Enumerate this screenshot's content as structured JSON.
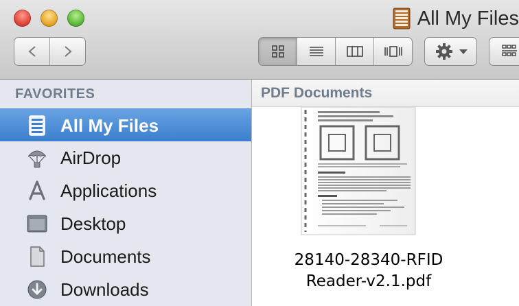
{
  "window": {
    "title": "All My Files",
    "title_icon": "all-my-files-icon"
  },
  "toolbar": {
    "nav_back_icon": "back-arrow-icon",
    "nav_forward_icon": "forward-arrow-icon",
    "views": [
      "icon-view",
      "list-view",
      "column-view",
      "cover-flow-view"
    ],
    "active_view": "icon-view",
    "action_icon": "gear-icon",
    "arrange_icon": "arrange-icon"
  },
  "sidebar": {
    "header": "FAVORITES",
    "items": [
      {
        "label": "All My Files",
        "icon": "all-my-files-icon",
        "selected": true
      },
      {
        "label": "AirDrop",
        "icon": "airdrop-icon",
        "selected": false
      },
      {
        "label": "Applications",
        "icon": "applications-icon",
        "selected": false
      },
      {
        "label": "Desktop",
        "icon": "desktop-icon",
        "selected": false
      },
      {
        "label": "Documents",
        "icon": "documents-icon",
        "selected": false
      },
      {
        "label": "Downloads",
        "icon": "downloads-icon",
        "selected": false
      }
    ]
  },
  "content": {
    "group_title": "PDF Documents",
    "files": [
      {
        "name_line1": "28140-28340-RFID",
        "name_line2": "Reader-v2.1.pdf",
        "icon": "pdf-document-icon"
      }
    ]
  },
  "colors": {
    "selection": "#3b7fce",
    "sidebar_bg": "#e4e8ee",
    "header_text": "#6e7c8b"
  }
}
